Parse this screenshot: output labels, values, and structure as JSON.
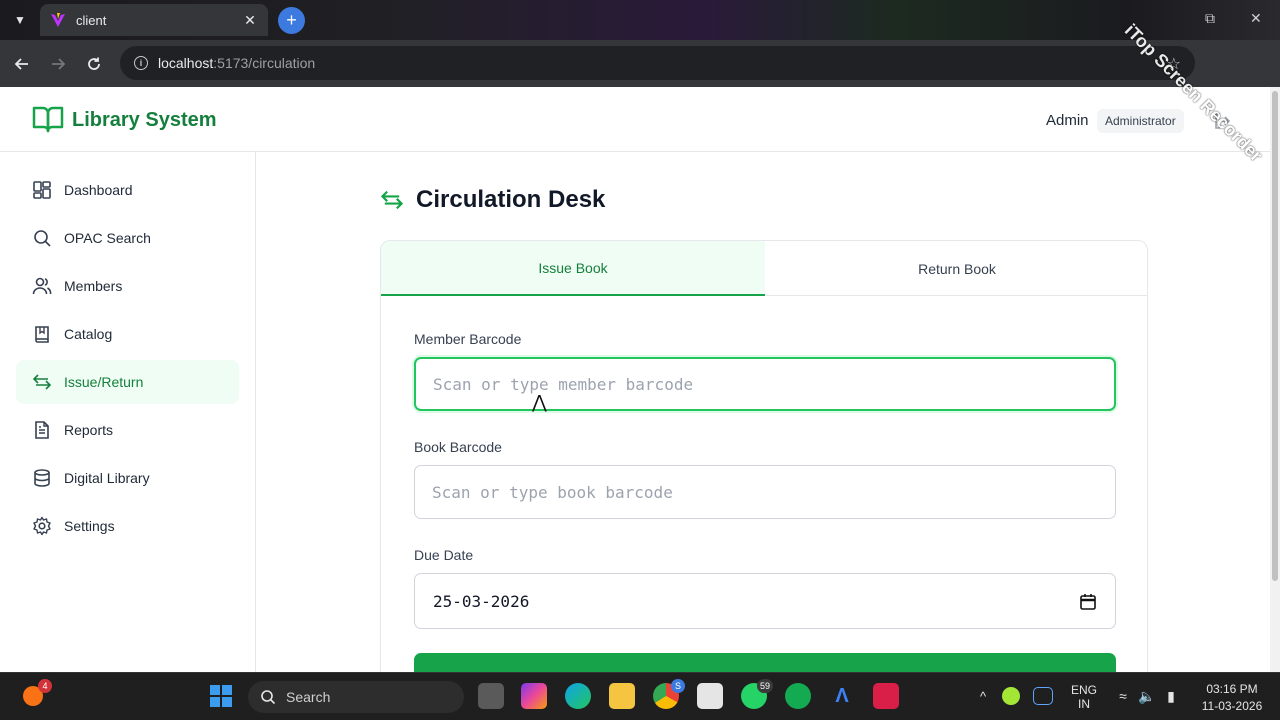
{
  "browser": {
    "tab_title": "client",
    "url_host": "localhost",
    "url_path": ":5173/circulation"
  },
  "header": {
    "brand": "Library System",
    "user_name": "Admin",
    "role": "Administrator"
  },
  "sidebar": {
    "items": [
      {
        "label": "Dashboard",
        "icon": "dashboard-icon"
      },
      {
        "label": "OPAC Search",
        "icon": "search-icon"
      },
      {
        "label": "Members",
        "icon": "users-icon"
      },
      {
        "label": "Catalog",
        "icon": "book-icon"
      },
      {
        "label": "Issue/Return",
        "icon": "swap-arrows-icon",
        "active": true
      },
      {
        "label": "Reports",
        "icon": "document-icon"
      },
      {
        "label": "Digital Library",
        "icon": "database-icon"
      },
      {
        "label": "Settings",
        "icon": "gear-icon"
      }
    ]
  },
  "main": {
    "title": "Circulation Desk",
    "tabs": [
      {
        "label": "Issue Book",
        "active": true
      },
      {
        "label": "Return Book"
      }
    ],
    "form": {
      "member_label": "Member Barcode",
      "member_placeholder": "Scan or type member barcode",
      "book_label": "Book Barcode",
      "book_placeholder": "Scan or type book barcode",
      "due_label": "Due Date",
      "due_value": "25-03-2026"
    }
  },
  "watermark": "iTop Screen Recorder",
  "taskbar": {
    "search_label": "Search",
    "badge_notifications": "4",
    "badge_whatsapp": "59",
    "badge_chrome": "S",
    "lang_line1": "ENG",
    "lang_line2": "IN",
    "time": "03:16 PM",
    "date": "11-03-2026"
  },
  "colors": {
    "accent": "#16a34a",
    "accent_text": "#15803d",
    "active_bg": "#f0fdf4"
  }
}
